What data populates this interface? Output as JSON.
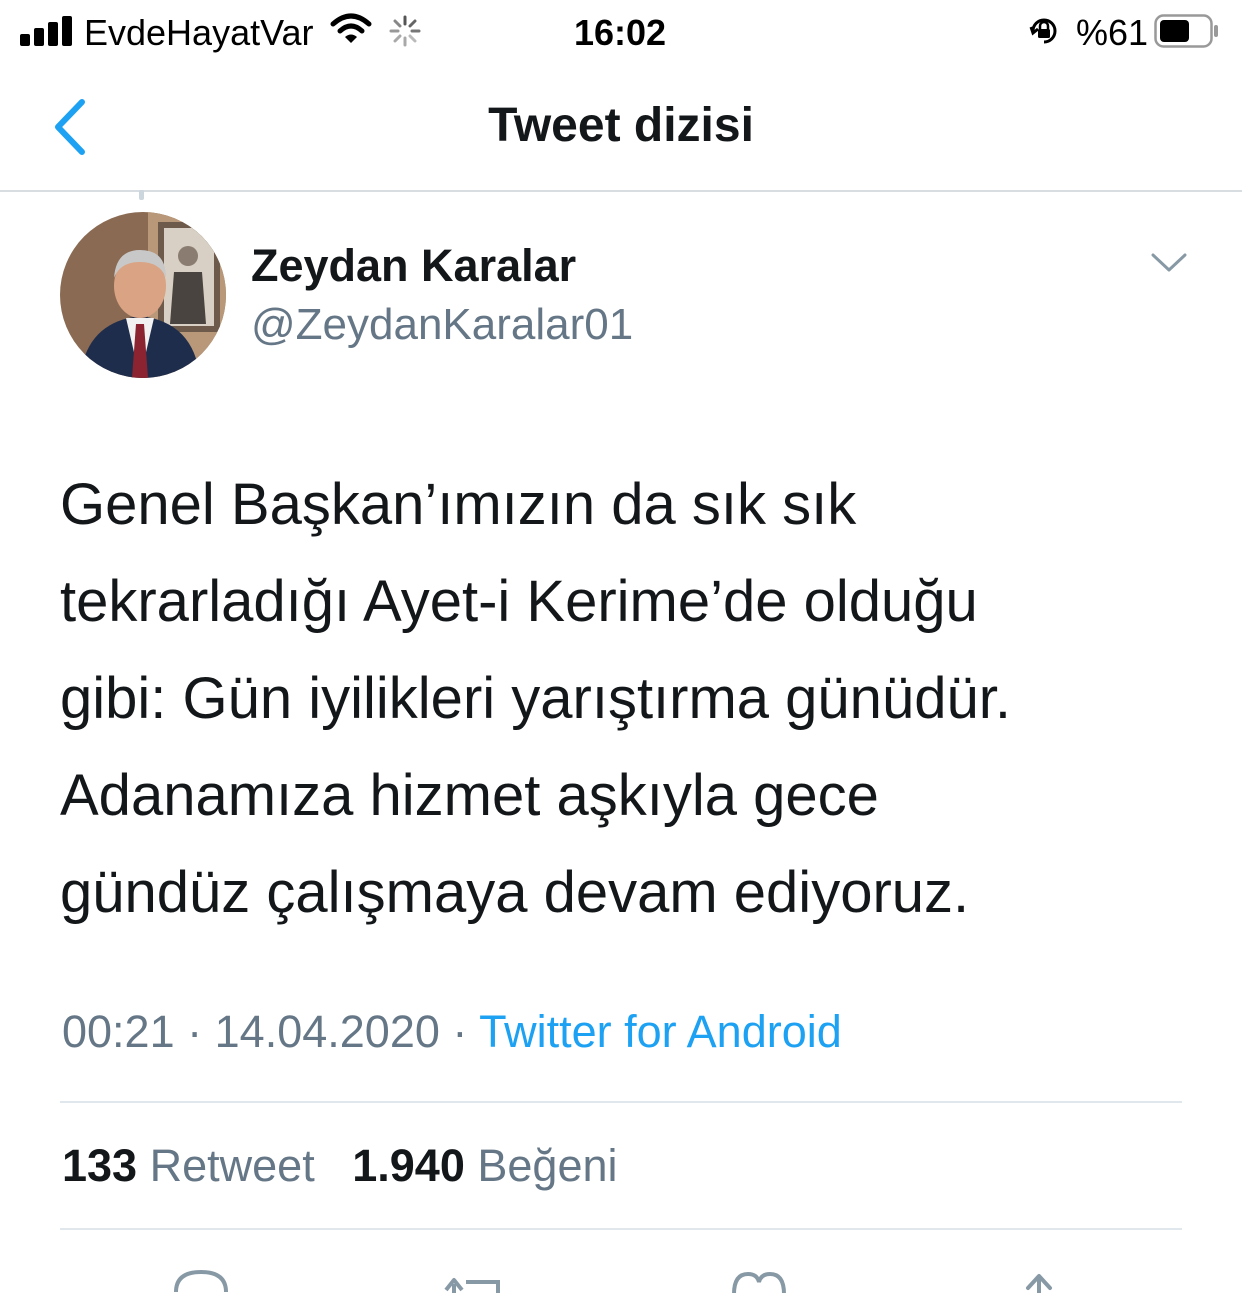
{
  "status_bar": {
    "carrier": "EvdeHayatVar",
    "time": "16:02",
    "battery_percent": "%61",
    "battery_level": 0.61,
    "signal_icon": "signal-bars-icon",
    "wifi_icon": "wifi-icon",
    "activity_icon": "loading-spinner-icon",
    "lock_icon": "orientation-lock-icon"
  },
  "nav": {
    "back_icon": "chevron-left-icon",
    "title": "Tweet dizisi"
  },
  "tweet": {
    "author": {
      "display_name": "Zeydan Karalar",
      "handle": "@ZeydanKaralar01",
      "avatar": "avatar-photo"
    },
    "menu_icon": "chevron-down-icon",
    "text_lines": [
      "Genel Başkan’ımızın da sık sık",
      "tekrarladığı Ayet-i Kerime’de olduğu",
      "gibi: Gün iyilikleri yarıştırma günüdür.",
      "Adanamıza hizmet aşkıyla gece",
      "gündüz çalışmaya devam ediyoruz."
    ],
    "time": "00:21",
    "separator": "·",
    "date": "14.04.2020",
    "source": "Twitter for Android",
    "retweet_count": "133",
    "retweet_label": "Retweet",
    "like_count": "1.940",
    "like_label": "Beğeni"
  },
  "actions": [
    {
      "icon": "reply-icon"
    },
    {
      "icon": "retweet-icon"
    },
    {
      "icon": "like-icon"
    },
    {
      "icon": "share-icon"
    }
  ],
  "colors": {
    "accent": "#1da1f2",
    "text_primary": "#14171a",
    "text_secondary": "#657786",
    "divider": "#e1e8ed"
  }
}
